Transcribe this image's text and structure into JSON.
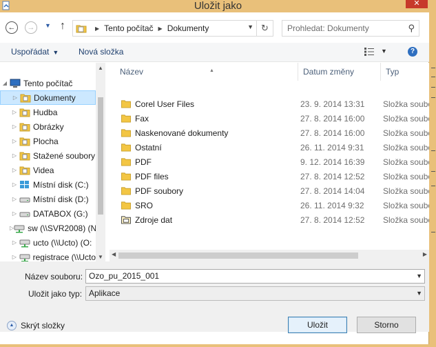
{
  "window": {
    "title": "Uložit jako",
    "close_glyph": "✕"
  },
  "address_bar": {
    "segments": [
      "Tento počítač",
      "Dokumenty"
    ]
  },
  "search": {
    "placeholder": "Prohledat: Dokumenty"
  },
  "toolbar": {
    "organize_label": "Uspořádat",
    "new_folder_label": "Nová složka",
    "help_label": "?"
  },
  "nav_tree": {
    "root": "Tento počítač",
    "items": [
      {
        "label": "Dokumenty",
        "icon": "documents-folder-icon",
        "selected": true
      },
      {
        "label": "Hudba",
        "icon": "music-folder-icon"
      },
      {
        "label": "Obrázky",
        "icon": "pictures-folder-icon"
      },
      {
        "label": "Plocha",
        "icon": "desktop-folder-icon"
      },
      {
        "label": "Stažené soubory",
        "icon": "downloads-folder-icon"
      },
      {
        "label": "Videa",
        "icon": "videos-folder-icon"
      },
      {
        "label": "Místní disk (C:)",
        "icon": "system-drive-icon"
      },
      {
        "label": "Místní disk (D:)",
        "icon": "drive-icon"
      },
      {
        "label": "DATABOX (G:)",
        "icon": "drive-icon"
      },
      {
        "label": "sw (\\\\SVR2008) (N",
        "icon": "network-drive-icon"
      },
      {
        "label": "ucto (\\\\Ucto) (O:",
        "icon": "network-drive-icon"
      },
      {
        "label": "registrace (\\\\Ucto",
        "icon": "network-drive-icon"
      }
    ]
  },
  "file_list": {
    "columns": {
      "name": "Název",
      "date": "Datum změny",
      "type": "Typ"
    },
    "rows": [
      {
        "name": "Corel User Files",
        "date": "23. 9. 2014 13:31",
        "type": "Složka soubo",
        "icon": "folder-icon"
      },
      {
        "name": "Fax",
        "date": "27. 8. 2014 16:00",
        "type": "Složka soubo",
        "icon": "folder-icon"
      },
      {
        "name": "Naskenované dokumenty",
        "date": "27. 8. 2014 16:00",
        "type": "Složka soubo",
        "icon": "folder-icon"
      },
      {
        "name": "Ostatní",
        "date": "26. 11. 2014 9:31",
        "type": "Složka soubo",
        "icon": "folder-icon"
      },
      {
        "name": "PDF",
        "date": "9. 12. 2014 16:39",
        "type": "Složka soubo",
        "icon": "folder-icon"
      },
      {
        "name": "PDF files",
        "date": "27. 8. 2014 12:52",
        "type": "Složka soubo",
        "icon": "folder-icon"
      },
      {
        "name": "PDF soubory",
        "date": "27. 8. 2014 14:04",
        "type": "Složka soubo",
        "icon": "folder-icon"
      },
      {
        "name": "SRO",
        "date": "26. 11. 2014 9:32",
        "type": "Složka soubo",
        "icon": "folder-icon"
      },
      {
        "name": "Zdroje dat",
        "date": "27. 8. 2014 12:52",
        "type": "Složka soubo",
        "icon": "data-sources-folder-icon"
      }
    ]
  },
  "form": {
    "filename_label": "Název souboru:",
    "filename_value": "Ozo_pu_2015_001",
    "filetype_label": "Uložit jako typ:",
    "filetype_value": "Aplikace"
  },
  "footer": {
    "hide_folders_label": "Skrýt složky",
    "save_label": "Uložit",
    "cancel_label": "Storno"
  },
  "colors": {
    "folder": "#f3c644",
    "selection": "#cce8ff",
    "accent": "#2f6fc0"
  }
}
